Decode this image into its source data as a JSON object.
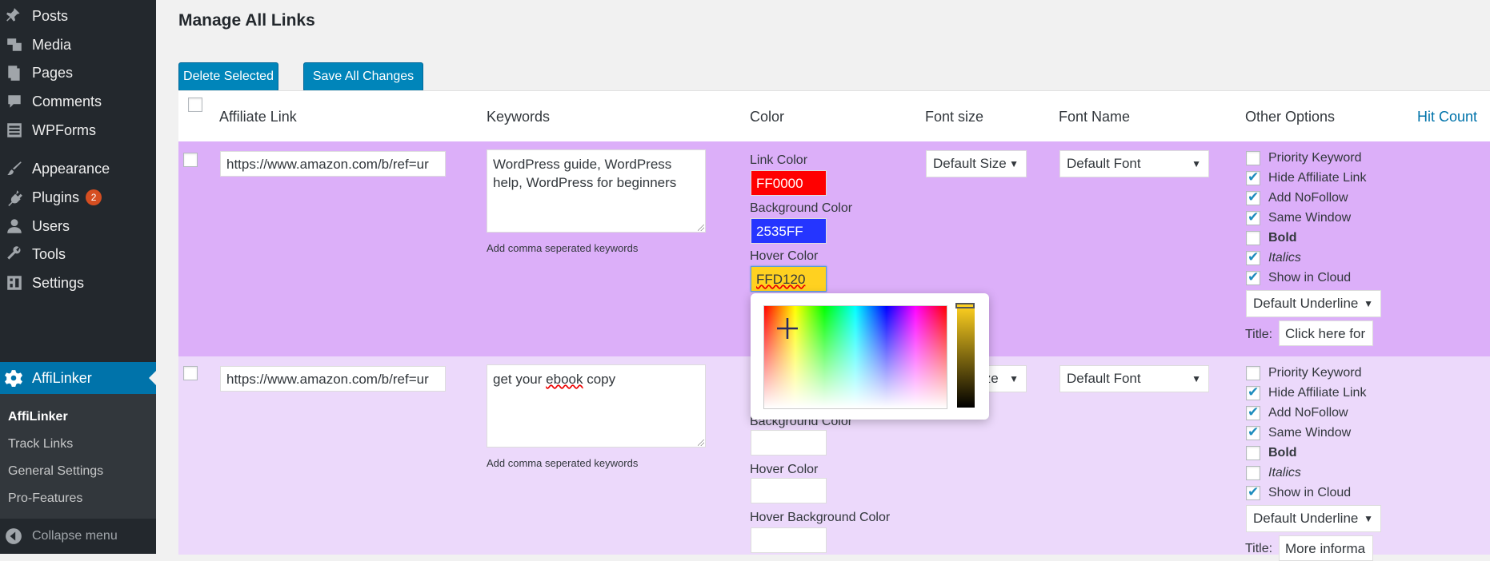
{
  "sidebar": {
    "items": [
      {
        "label": "Posts",
        "icon": "pin-icon"
      },
      {
        "label": "Media",
        "icon": "media-icon"
      },
      {
        "label": "Pages",
        "icon": "pages-icon"
      },
      {
        "label": "Comments",
        "icon": "comment-icon"
      },
      {
        "label": "WPForms",
        "icon": "forms-icon"
      },
      {
        "label": "Appearance",
        "icon": "brush-icon"
      },
      {
        "label": "Plugins",
        "icon": "plug-icon",
        "badge": "2"
      },
      {
        "label": "Users",
        "icon": "user-icon"
      },
      {
        "label": "Tools",
        "icon": "wrench-icon"
      },
      {
        "label": "Settings",
        "icon": "settings-icon"
      }
    ],
    "active": {
      "label": "AffiLinker",
      "icon": "gear-icon"
    },
    "submenu": [
      "AffiLinker",
      "Track Links",
      "General Settings",
      "Pro-Features"
    ],
    "collapse_label": "Collapse menu"
  },
  "page": {
    "title": "Manage All Links",
    "delete_label": "Delete Selected",
    "save_label": "Save All Changes"
  },
  "table": {
    "headers": {
      "affiliate_link": "Affiliate Link",
      "keywords": "Keywords",
      "color": "Color",
      "font_size": "Font size",
      "font_name": "Font Name",
      "other_options": "Other Options",
      "hit_count": "Hit Count"
    },
    "rows": [
      {
        "link": "https://www.amazon.com/b/ref=ur",
        "keywords": "WordPress guide, WordPress help, WordPress for beginners",
        "hint": "Add comma seperated keywords",
        "link_color_label": "Link Color",
        "link_color": "FF0000",
        "bg_color_label": "Background Color",
        "bg_color": "2535FF",
        "hover_color_label": "Hover Color",
        "hover_color": "FFD120",
        "font_size": "Default Size",
        "font_name": "Default Font",
        "options": [
          {
            "label": "Priority Keyword",
            "checked": false
          },
          {
            "label": "Hide Affiliate Link",
            "checked": true
          },
          {
            "label": "Add NoFollow",
            "checked": true
          },
          {
            "label": "Same Window",
            "checked": true
          },
          {
            "label": "Bold",
            "checked": false
          },
          {
            "label": "Italics",
            "checked": true
          },
          {
            "label": "Show in Cloud",
            "checked": true
          }
        ],
        "underline": "Default Underline",
        "title_label": "Title:",
        "title_value": "Click here for"
      },
      {
        "link": "https://www.amazon.com/b/ref=ur",
        "keywords_pre": "get your ",
        "keywords_spell": "ebook",
        "keywords_post": " copy",
        "hint": "Add comma seperated keywords",
        "bg_color_label": "Background Color",
        "hover_color_label": "Hover Color",
        "hover_bg_label": "Hover Background Color",
        "font_size": "ize",
        "font_name": "Default Font",
        "options": [
          {
            "label": "Priority Keyword",
            "checked": false
          },
          {
            "label": "Hide Affiliate Link",
            "checked": true
          },
          {
            "label": "Add NoFollow",
            "checked": true
          },
          {
            "label": "Same Window",
            "checked": true
          },
          {
            "label": "Bold",
            "checked": false
          },
          {
            "label": "Italics",
            "checked": false
          },
          {
            "label": "Show in Cloud",
            "checked": true
          }
        ],
        "underline": "Default Underline",
        "title_label": "Title:",
        "title_value": "More informa"
      }
    ]
  },
  "colors": {
    "row1_bg": "#dcaff9",
    "row2_bg": "#ecd9fb",
    "link_color": "#ff0000",
    "bg_color": "#2535ff",
    "hover_color": "#ffd120",
    "accent": "#0073aa"
  }
}
